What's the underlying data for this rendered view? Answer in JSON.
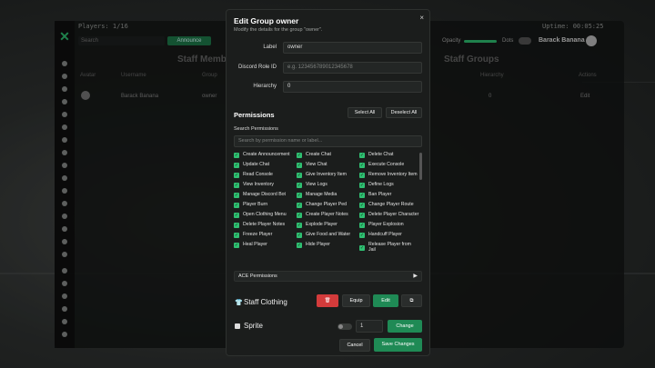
{
  "background": {
    "players": "Players: 1/16",
    "uptime": "Uptime: 00:05:25",
    "search_placeholder": "Search",
    "announce_label": "Announce",
    "volume_label": "Opacity",
    "dots_label": "Dots",
    "user_name": "Barack Banana",
    "staff_members_title": "Staff Members",
    "staff_groups_title": "Staff Groups",
    "col_avatar": "Avatar",
    "col_username": "Username",
    "col_group": "Group",
    "col_hierarchy": "Hierarchy",
    "col_actions": "Actions",
    "row_name": "Barack Banana",
    "row_group": "owner",
    "row_hierarchy": "0",
    "row_action": "Edit"
  },
  "modal": {
    "title": "Edit Group owner",
    "subtitle": "Modify the details for the group \"owner\".",
    "close_icon": "×",
    "fields": {
      "label_label": "Label",
      "label_value": "owner",
      "discord_label": "Discord Role ID",
      "discord_placeholder": "e.g. 123456789012345678",
      "hierarchy_label": "Hierarchy",
      "hierarchy_value": "0"
    },
    "permissions_heading": "Permissions",
    "select_all": "Select All",
    "deselect_all": "Deselect All",
    "search_label": "Search Permissions",
    "search_placeholder": "Search by permission name or label...",
    "permissions": [
      [
        "Create Announcement",
        "Create Chat",
        "Delete Chat"
      ],
      [
        "Update Chat",
        "View Chat",
        "Execute Console"
      ],
      [
        "Read Console",
        "Give Inventory Item",
        "Remove Inventory Item"
      ],
      [
        "View Inventory",
        "View Logs",
        "Define Logs"
      ],
      [
        "Manage Discord Bot",
        "Manage Media",
        "Ban Player"
      ],
      [
        "Player Burn",
        "Change Player Ped",
        "Change Player Route"
      ],
      [
        "Open Clothing Menu",
        "Create Player Notes",
        "Delete Player Character"
      ],
      [
        "Delete Player Notes",
        "Explode Player",
        "Player Explosion"
      ],
      [
        "Freeze Player",
        "Give Food and Water",
        "Handcuff Player"
      ],
      [
        "Heal Player",
        "Hide Player",
        "Release Player from Jail"
      ]
    ],
    "ace_label": "ACE Permissions",
    "ace_icon": "▶",
    "staff_clothing_label": "Staff Clothing",
    "staff_clothing_icon": "👕",
    "clothing_delete_icon": "🗑",
    "equip_label": "Equip",
    "edit_label": "Edit",
    "clothing_copy_icon": "⧉",
    "sprite_label": "Sprite",
    "sprite_value": "1",
    "change_label": "Change",
    "cancel_label": "Cancel",
    "save_label": "Save Changes"
  }
}
